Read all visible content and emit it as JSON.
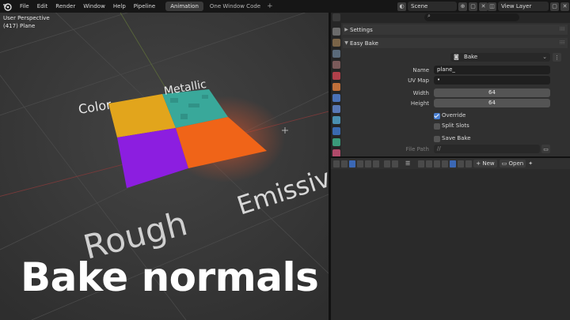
{
  "menu": [
    "File",
    "Edit",
    "Render",
    "Window",
    "Help",
    "Pipeline"
  ],
  "workspace_tabs": [
    {
      "label": "Animation",
      "active": true
    },
    {
      "label": "One Window Code",
      "active": false
    }
  ],
  "workspace_add": "+",
  "scene_label": "Scene",
  "view_layer_label": "View Layer",
  "viewport": {
    "mode": "User Perspective",
    "object": "(417) Plane",
    "labels": {
      "color": "Color",
      "metallic": "Metallic",
      "emissive": "Emissive",
      "rough": "Rough"
    }
  },
  "overlay_title": "Bake normals",
  "properties": {
    "search_icon": "search-icon",
    "settings_label": "Settings",
    "easy_bake_label": "Easy Bake",
    "bake_button": "Bake",
    "name_label": "Name",
    "name_value": "plane_",
    "uvmap_label": "UV Map",
    "uvmap_value": "•",
    "width_label": "Width",
    "width_value": "64",
    "height_label": "Height",
    "height_value": "64",
    "override_label": "Override",
    "override_checked": true,
    "split_slots_label": "Split Slots",
    "split_slots_checked": false,
    "save_bake_label": "Save Bake",
    "save_bake_checked": false,
    "file_path_label": "File Path",
    "file_path_value": "//"
  },
  "image_editor": {
    "new_label": "New",
    "open_label": "Open"
  },
  "colors": {
    "color_tile": "#e2a51c",
    "metallic_tile": "#39a89a",
    "rough_tile": "#8c1ee0",
    "emissive_tile": "#f06418",
    "accent": "#4a7fd0"
  }
}
